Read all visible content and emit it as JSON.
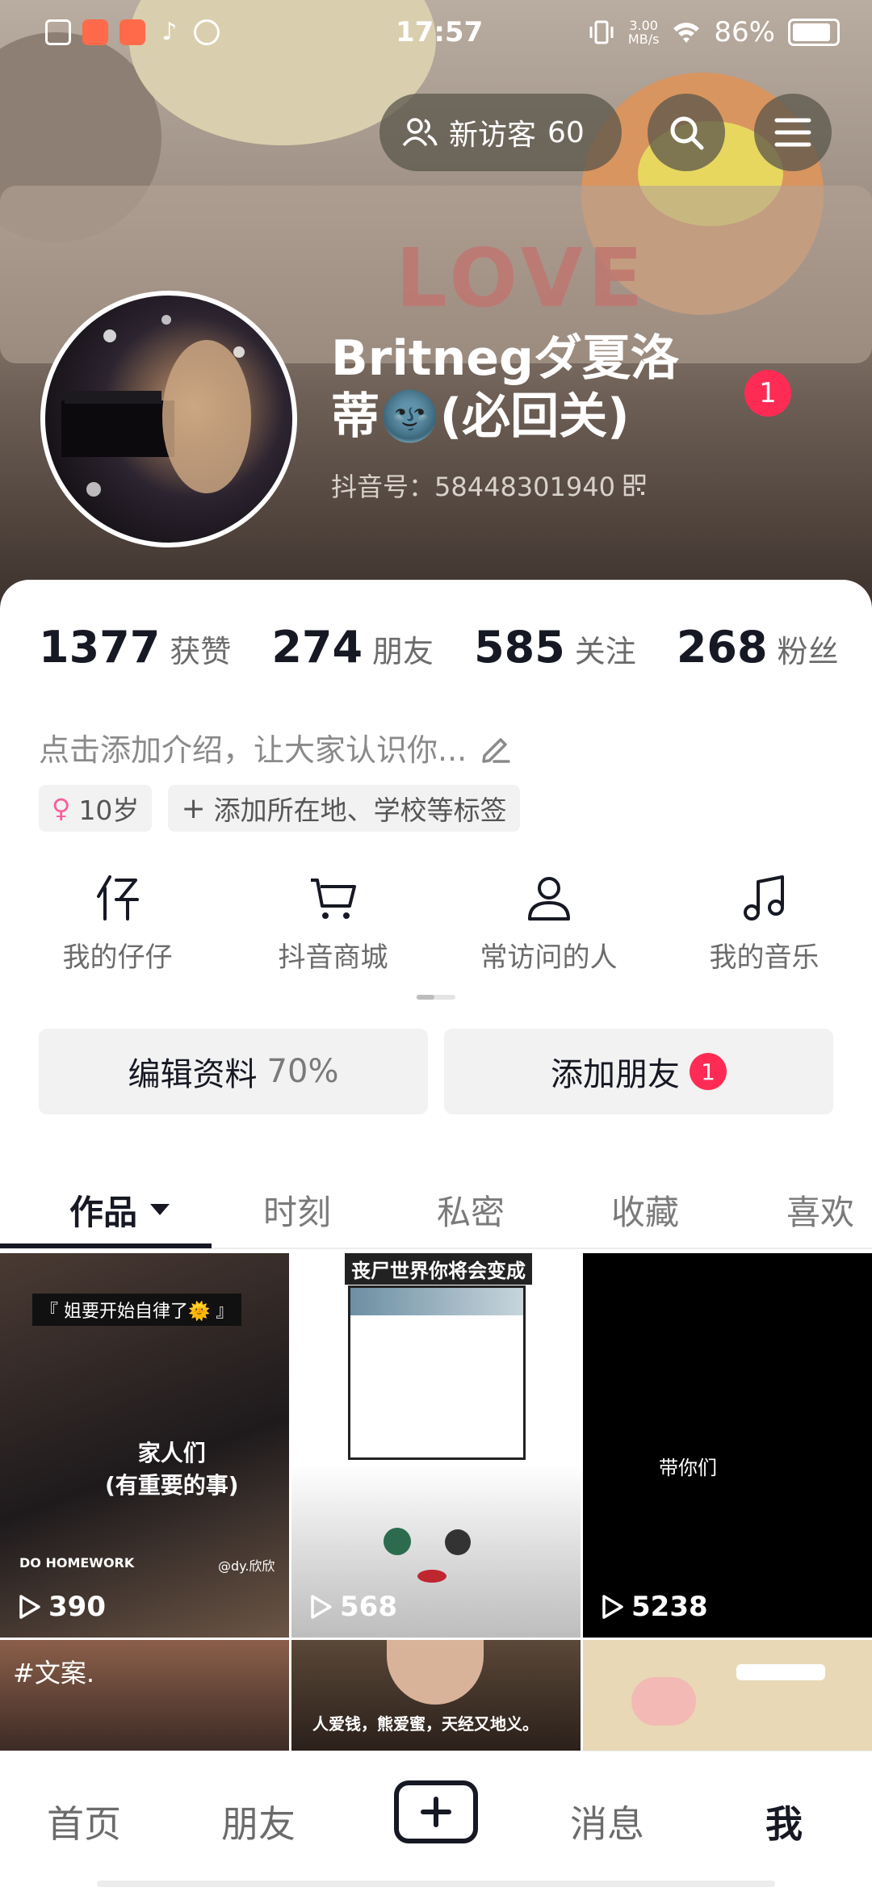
{
  "status_bar": {
    "time": "17:57",
    "net_speed_value": "3.00",
    "net_speed_unit": "MB/s",
    "battery": "86%"
  },
  "header": {
    "visitor_label": "新访客",
    "visitor_count": "60",
    "name_line1": "Britnegダ夏洛",
    "name_line2": "蒂🌚(必回关)",
    "douyin_id": "抖音号：58448301940",
    "notification_count": "1"
  },
  "stats": [
    {
      "value": "1377",
      "label": "获赞"
    },
    {
      "value": "274",
      "label": "朋友"
    },
    {
      "value": "585",
      "label": "关注"
    },
    {
      "value": "268",
      "label": "粉丝"
    }
  ],
  "bio": {
    "placeholder": "点击添加介绍，让大家认识你..."
  },
  "tags": [
    {
      "label": "10岁",
      "icon": "female-symbol-icon"
    },
    {
      "label": "添加所在地、学校等标签",
      "icon": "plus-icon"
    }
  ],
  "shortcuts": [
    {
      "label": "我的仔仔",
      "icon": "zaizai-icon"
    },
    {
      "label": "抖音商城",
      "icon": "cart-icon"
    },
    {
      "label": "常访问的人",
      "icon": "person-icon"
    },
    {
      "label": "我的音乐",
      "icon": "music-note-icon"
    }
  ],
  "actions": {
    "edit_profile_label": "编辑资料",
    "edit_profile_progress": "70%",
    "add_friend_label": "添加朋友",
    "add_friend_badge": "1"
  },
  "tabs": [
    {
      "label": "作品",
      "active": true
    },
    {
      "label": "时刻"
    },
    {
      "label": "私密"
    },
    {
      "label": "收藏"
    },
    {
      "label": "喜欢"
    }
  ],
  "videos": [
    {
      "plays": "390",
      "caption_top": "『 姐要开始自律了🌞 』",
      "caption_mid": "家人们\n(有重要的事)",
      "caption_bottom": "DO HOMEWORK",
      "watermark": "@dy.欣欣"
    },
    {
      "plays": "568",
      "caption_top": "丧尸世界你将会变成"
    },
    {
      "plays": "5238",
      "caption_mid": "带你们"
    },
    {
      "caption_top": "#文案."
    },
    {
      "caption_bottom": "人爱钱，熊爱蜜，天经又地义。"
    },
    {}
  ],
  "bottom_nav": [
    {
      "label": "首页"
    },
    {
      "label": "朋友"
    },
    {
      "label": "消息"
    },
    {
      "label": "我",
      "active": true
    }
  ],
  "colors": {
    "accent_red": "#fe2c55",
    "text_primary": "#161823",
    "text_secondary": "#6b6b6b"
  }
}
